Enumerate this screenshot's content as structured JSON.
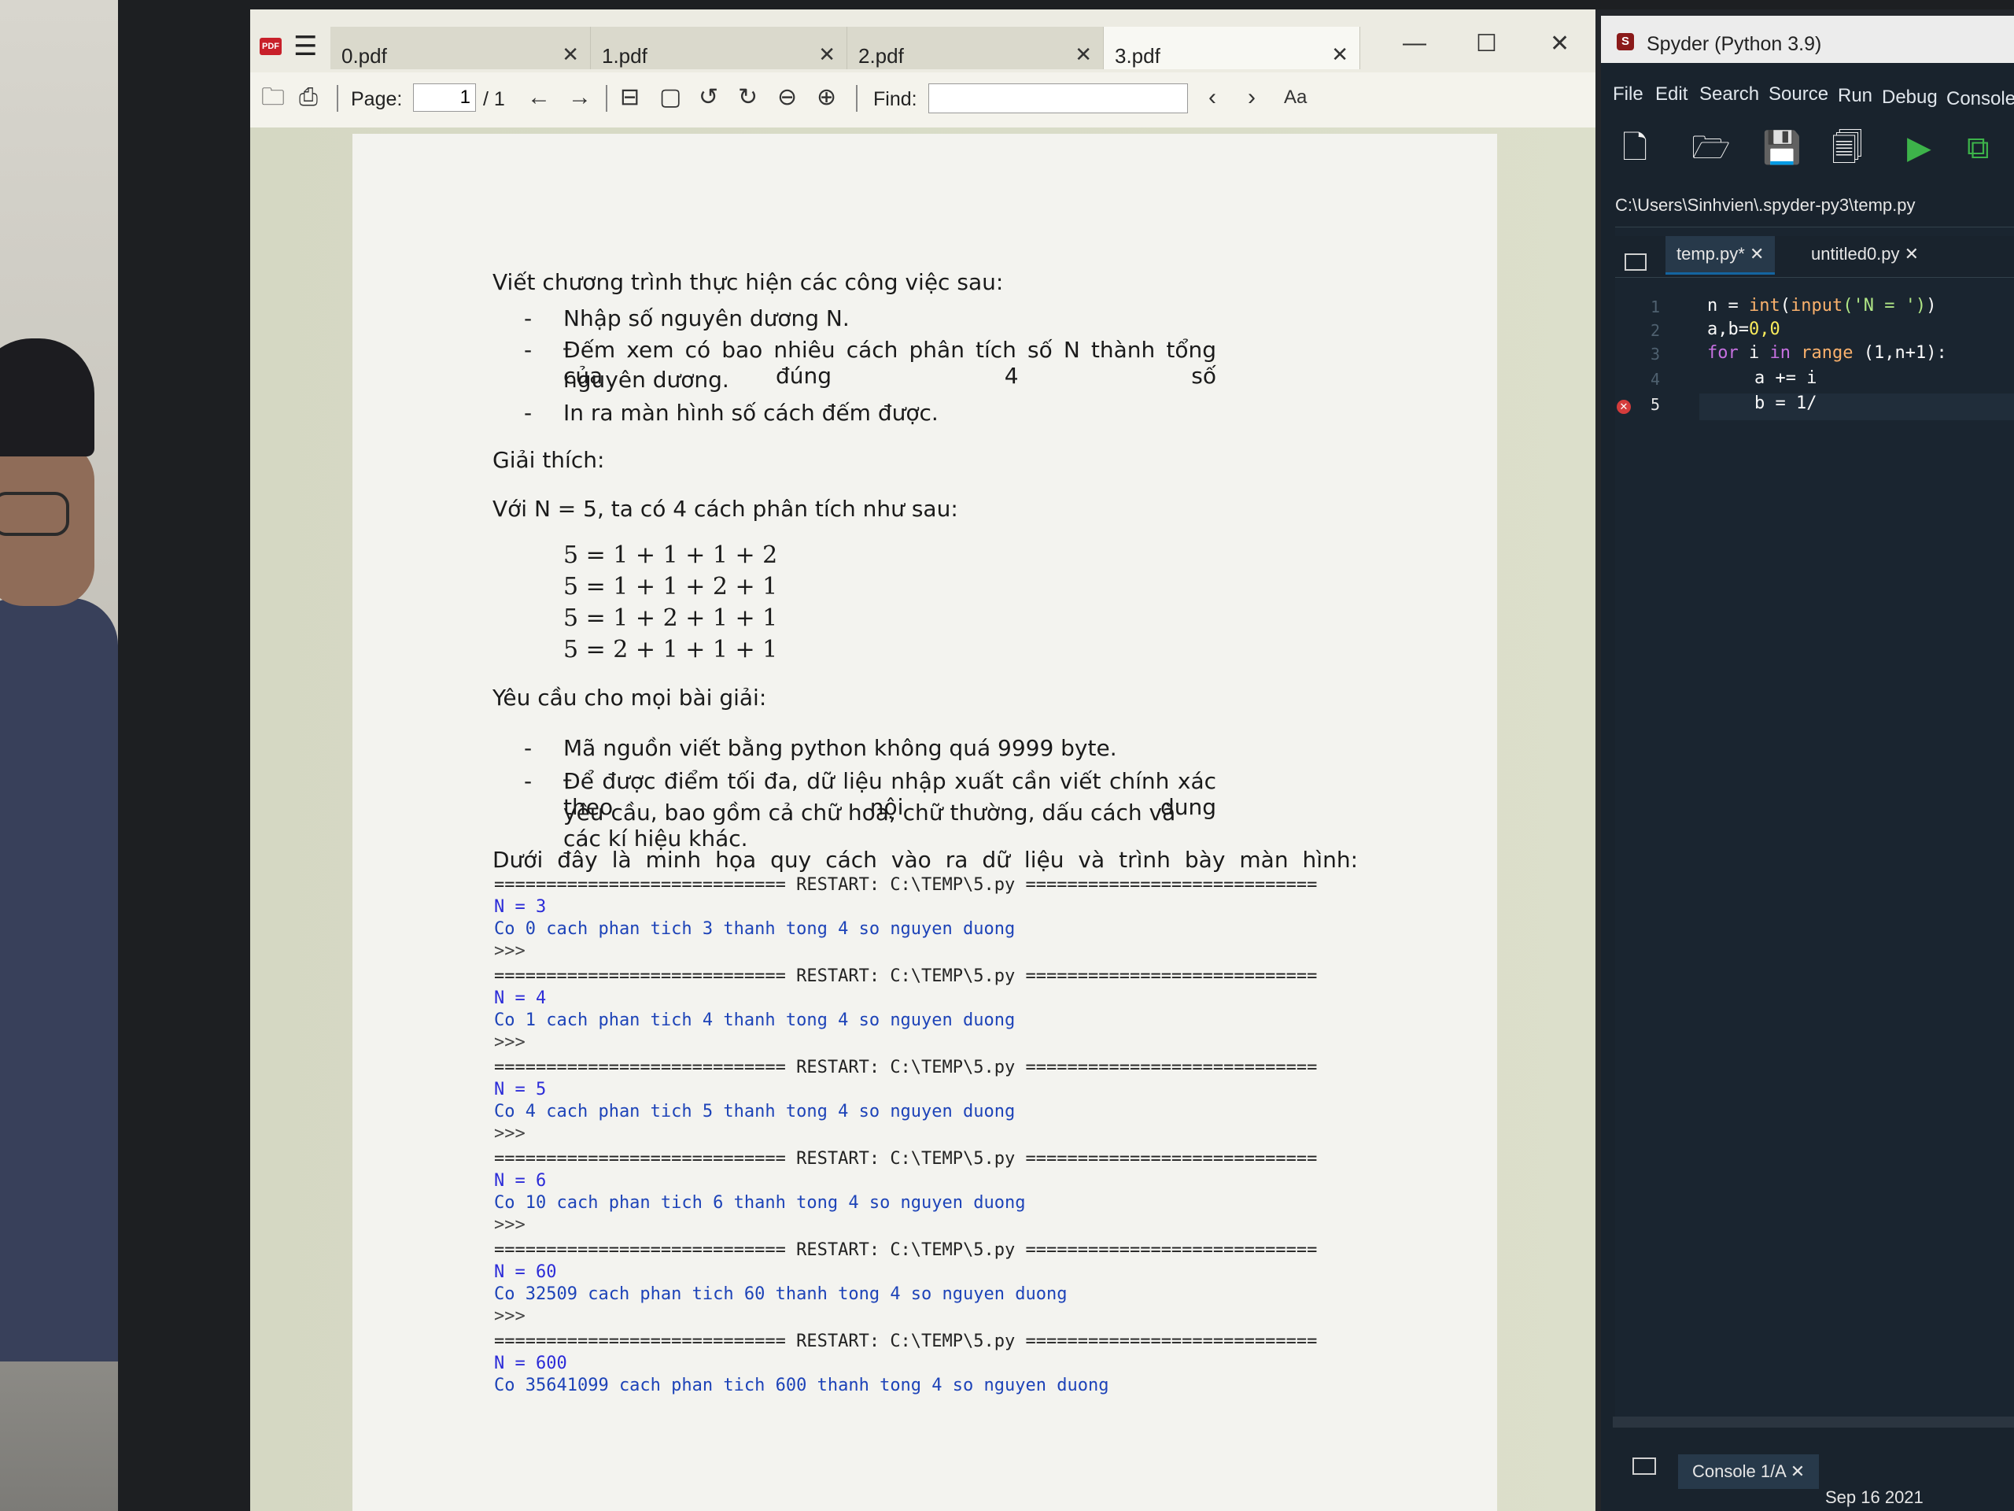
{
  "pdf_viewer": {
    "tabs": [
      {
        "label": "0.pdf",
        "active": false
      },
      {
        "label": "1.pdf",
        "active": false
      },
      {
        "label": "2.pdf",
        "active": false
      },
      {
        "label": "3.pdf",
        "active": true
      }
    ],
    "toolbar": {
      "page_label": "Page:",
      "page_current": "1",
      "page_total": "/ 1",
      "find_label": "Find:",
      "find_value": ""
    }
  },
  "document": {
    "intro": "Viết chương trình thực hiện các công việc sau:",
    "tasks": [
      "Nhập số nguyên dương N.",
      "Đếm xem có bao nhiêu cách phân tích số N thành tổng của đúng 4 số",
      "nguyên dương.",
      "In ra màn hình số cách đếm được."
    ],
    "explain_heading": "Giải thích:",
    "example_intro": "Với N = 5, ta có 4 cách phân tích như sau:",
    "equations": [
      "5 = 1 + 1 + 1 + 2",
      "5 = 1 + 1 + 2 + 1",
      "5 = 1 + 2 + 1 + 1",
      "5 = 2 + 1 + 1 + 1"
    ],
    "requirements_heading": "Yêu cầu cho mọi bài giải:",
    "requirements": [
      "Mã nguồn viết bằng python không quá 9999 byte.",
      "Để được điểm tối đa, dữ liệu nhập xuất cần viết chính xác theo nội dung",
      "yêu cầu, bao gồm cả chữ hoa, chữ thường, dấu cách và các kí hiệu khác."
    ],
    "io_intro": "Dưới đây là minh họa quy cách vào ra dữ liệu và trình bày màn hình:",
    "console_runs": [
      {
        "restart": "============================ RESTART: C:\\TEMP\\5.py ============================",
        "input": "N = 3",
        "output": "Co 0 cach phan tich 3 thanh tong 4 so nguyen duong",
        "prompt": ">>>"
      },
      {
        "restart": "============================ RESTART: C:\\TEMP\\5.py ============================",
        "input": "N = 4",
        "output": "Co 1 cach phan tich 4 thanh tong 4 so nguyen duong",
        "prompt": ">>>"
      },
      {
        "restart": "============================ RESTART: C:\\TEMP\\5.py ============================",
        "input": "N = 5",
        "output": "Co 4 cach phan tich 5 thanh tong 4 so nguyen duong",
        "prompt": ">>>"
      },
      {
        "restart": "============================ RESTART: C:\\TEMP\\5.py ============================",
        "input": "N = 6",
        "output": "Co 10 cach phan tich 6 thanh tong 4 so nguyen duong",
        "prompt": ">>>"
      },
      {
        "restart": "============================ RESTART: C:\\TEMP\\5.py ============================",
        "input": "N = 60",
        "output": "Co 32509 cach phan tich 60 thanh tong 4 so nguyen duong",
        "prompt": ">>>"
      },
      {
        "restart": "============================ RESTART: C:\\TEMP\\5.py ============================",
        "input": "N = 600",
        "output": "Co 35641099 cach phan tich 600 thanh tong 4 so nguyen duong",
        "prompt": ""
      }
    ]
  },
  "spyder": {
    "title": "Spyder (Python 3.9)",
    "menu": [
      "File",
      "Edit",
      "Search",
      "Source",
      "Run",
      "Debug",
      "Console"
    ],
    "path": "C:\\Users\\Sinhvien\\.spyder-py3\\temp.py",
    "editor_tabs": [
      {
        "label": "temp.py*",
        "active": true
      },
      {
        "label": "untitled0.py",
        "active": false
      }
    ],
    "line_numbers": [
      "1",
      "2",
      "3",
      "4",
      "5"
    ],
    "code": {
      "l1_var": "n = ",
      "l1_fn1": "int",
      "l1_p1": "(",
      "l1_fn2": "input",
      "l1_str": "('N = ')",
      "l1_end": ")",
      "l2_a": "a,b=",
      "l2_n": "0,0",
      "l3_for": "for",
      "l3_i": " i ",
      "l3_in": "in",
      "l3_range": " range",
      "l3_rest": " (1,n+1):",
      "l4": "a += i",
      "l5": "b = 1/"
    },
    "console_tab": "Console 1/A",
    "status_fragment": "Sep 16 2021"
  },
  "colors": {
    "spyder_bg": "#19232d",
    "console_output": "#1d43b8",
    "error_marker": "#d43c3c"
  }
}
